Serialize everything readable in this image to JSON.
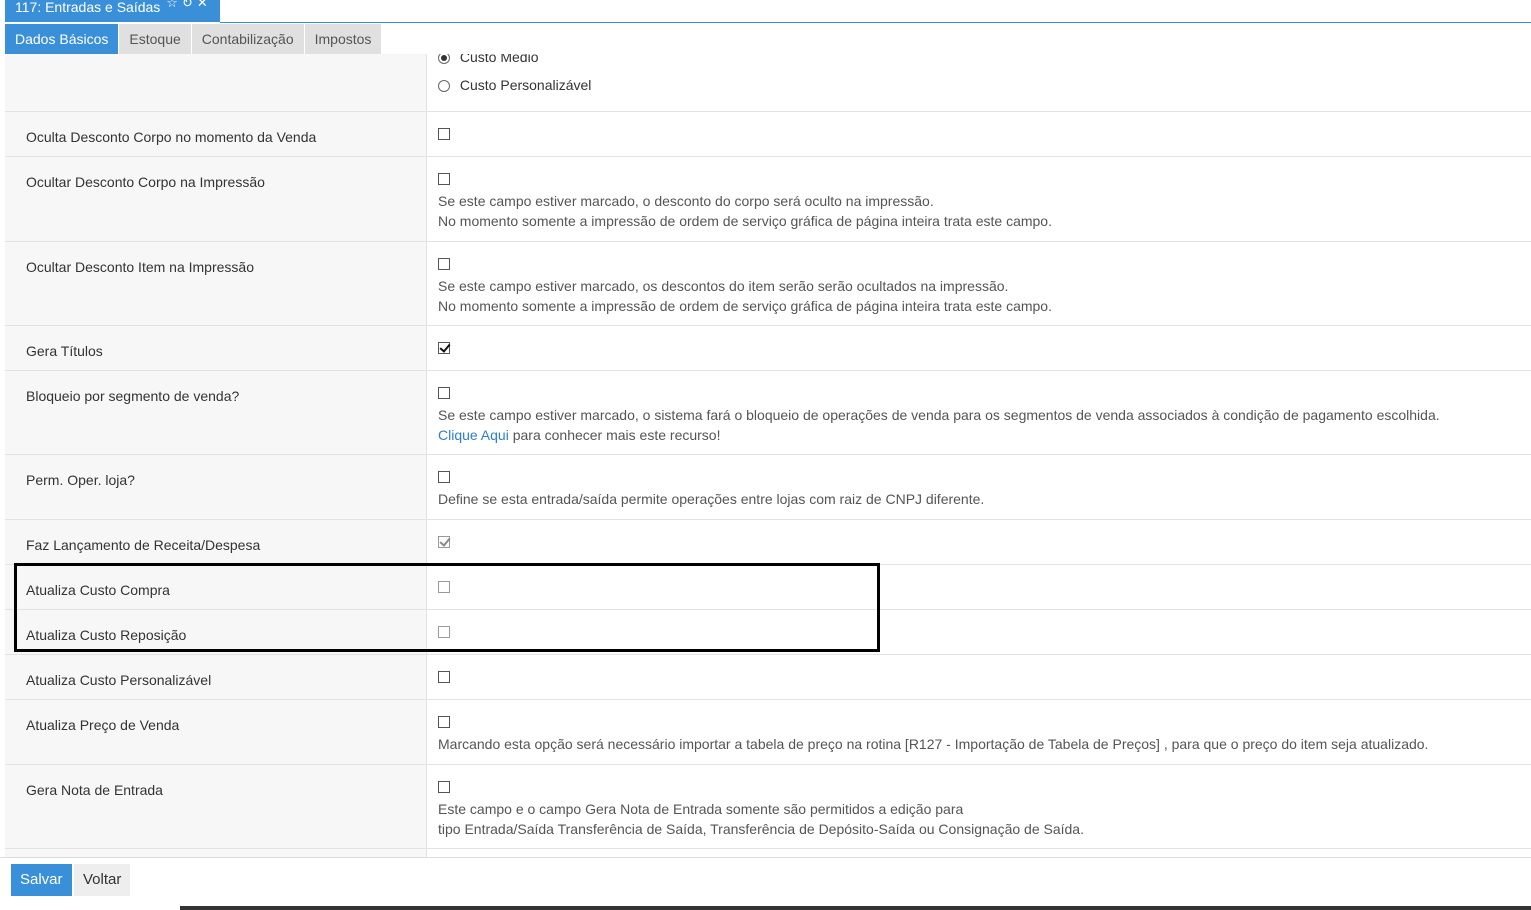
{
  "window": {
    "title": "117: Entradas e Saídas",
    "icons": [
      "star-icon",
      "refresh-icon",
      "close-icon"
    ]
  },
  "tabs": [
    {
      "label": "Dados Básicos",
      "active": true
    },
    {
      "label": "Estoque",
      "active": false
    },
    {
      "label": "Contabilização",
      "active": false
    },
    {
      "label": "Impostos",
      "active": false
    }
  ],
  "cost_options": {
    "custo_medio": "Custo Médio",
    "custo_personalizavel": "Custo Personalizável"
  },
  "rows": {
    "oculta_desconto_venda": {
      "label": "Oculta Desconto Corpo no momento da Venda",
      "checked": false
    },
    "ocultar_desconto_corpo": {
      "label": "Ocultar Desconto Corpo na Impressão",
      "checked": false,
      "desc1": "Se este campo estiver marcado, o desconto do corpo será oculto na impressão.",
      "desc2": "No momento somente a impressão de ordem de serviço gráfica de página inteira trata este campo."
    },
    "ocultar_desconto_item": {
      "label": "Ocultar Desconto Item na Impressão",
      "checked": false,
      "desc1": "Se este campo estiver marcado, os descontos do item serão serão ocultados na impressão.",
      "desc2": "No momento somente a impressão de ordem de serviço gráfica de página inteira trata este campo."
    },
    "gera_titulos": {
      "label": "Gera Títulos",
      "checked": true
    },
    "bloqueio_segmento": {
      "label": "Bloqueio por segmento de venda?",
      "checked": false,
      "desc1": "Se este campo estiver marcado, o sistema fará o bloqueio de operações de venda para os segmentos de venda associados à condição de pagamento escolhida.",
      "link": "Clique Aqui",
      "desc2": " para conhecer mais este recurso!"
    },
    "perm_oper_loja": {
      "label": "Perm. Oper. loja?",
      "checked": false,
      "desc1": "Define se esta entrada/saída permite operações entre lojas com raiz de CNPJ diferente."
    },
    "faz_lancamento": {
      "label": "Faz Lançamento de Receita/Despesa",
      "checked": true
    },
    "atualiza_custo_compra": {
      "label": "Atualiza Custo Compra",
      "checked": false
    },
    "atualiza_custo_reposicao": {
      "label": "Atualiza Custo Reposição",
      "checked": false
    },
    "atualiza_custo_personalizavel": {
      "label": "Atualiza Custo Personalizável",
      "checked": false
    },
    "atualiza_preco_venda": {
      "label": "Atualiza Preço de Venda",
      "checked": false,
      "desc1": "Marcando esta opção será necessário importar a tabela de preço na rotina [R127 - Importação de Tabela de Preços] , para que o preço do item seja atualizado."
    },
    "gera_nota_entrada": {
      "label": "Gera Nota de Entrada",
      "checked": false,
      "desc1": "Este campo e o campo Gera Nota de Entrada somente são permitidos a edição para",
      "desc2": "tipo Entrada/Saída Transferência de Saída, Transferência de Depósito-Saída ou Consignação de Saída."
    }
  },
  "footer": {
    "save": "Salvar",
    "back": "Voltar"
  }
}
